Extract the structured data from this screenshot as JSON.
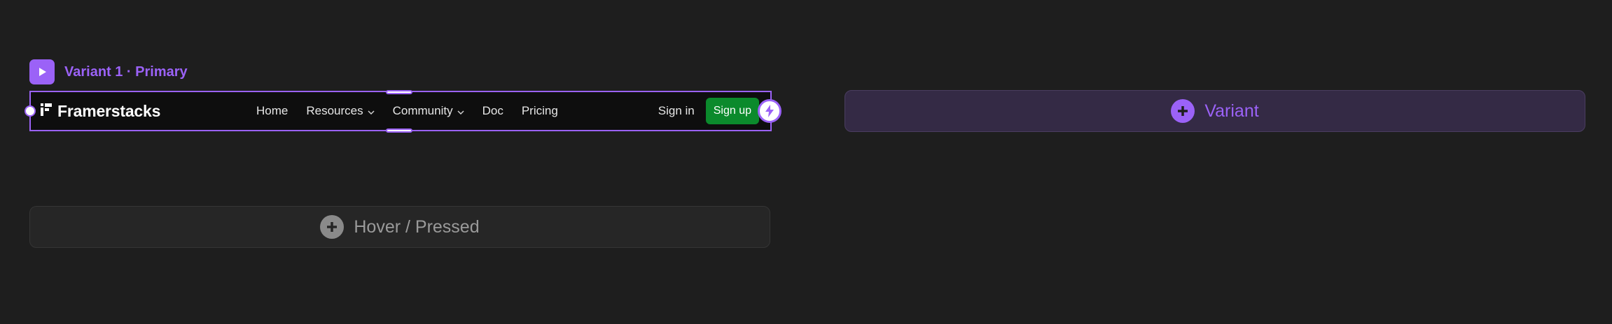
{
  "variant_label": {
    "title": "Variant 1 · Primary",
    "icon": "play-icon"
  },
  "navbar": {
    "logo_text": "Framerstacks",
    "logo_icon": "framer-logo-icon",
    "links": [
      {
        "label": "Home",
        "has_dropdown": false
      },
      {
        "label": "Resources",
        "has_dropdown": true
      },
      {
        "label": "Community",
        "has_dropdown": true
      },
      {
        "label": "Doc",
        "has_dropdown": false
      },
      {
        "label": "Pricing",
        "has_dropdown": false
      }
    ],
    "signin_label": "Sign in",
    "signup_label": "Sign up"
  },
  "add_variant": {
    "label": "Variant",
    "icon": "plus-circle-icon"
  },
  "hover_state": {
    "label": "Hover / Pressed",
    "icon": "plus-circle-icon"
  },
  "colors": {
    "canvas_bg": "#1e1e1e",
    "accent": "#9b62f7",
    "signup_bg": "#0b8a2c",
    "navbar_bg": "#0e0e0e",
    "variant_button_bg": "#342a45",
    "hover_button_bg": "#262626"
  }
}
